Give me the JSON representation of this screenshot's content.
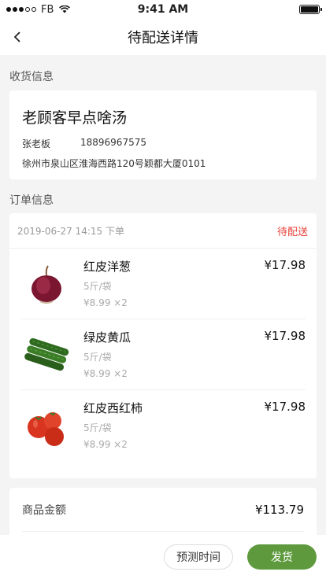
{
  "status_bar": {
    "carrier": "FB",
    "time": "9:41 AM"
  },
  "nav": {
    "title": "待配送详情",
    "back_icon": "chevron-left-icon"
  },
  "sections": {
    "receiver": "收货信息",
    "order": "订单信息"
  },
  "receiver": {
    "shop_name": "老顾客早点啥汤",
    "contact_name": "张老板",
    "phone": "18896967575",
    "address": "徐州市泉山区淮海西路120号颖都大厦0101"
  },
  "order": {
    "time": "2019-06-27 14:15 下单",
    "status": "待配送",
    "items": [
      {
        "name": "红皮洋葱",
        "spec": "5斤/袋",
        "unit_qty": "¥8.99 ×2",
        "price": "¥17.98",
        "icon": "onion-icon"
      },
      {
        "name": "绿皮黄瓜",
        "spec": "5斤/袋",
        "unit_qty": "¥8.99 ×2",
        "price": "¥17.98",
        "icon": "cucumber-icon"
      },
      {
        "name": "红皮西红柿",
        "spec": "5斤/袋",
        "unit_qty": "¥8.99 ×2",
        "price": "¥17.98",
        "icon": "tomato-icon"
      }
    ]
  },
  "summary": {
    "label": "商品金额",
    "value": "¥113.79"
  },
  "actions": {
    "predict_time": "预测时间",
    "ship": "发货"
  },
  "colors": {
    "accent_green": "#5e9a3d",
    "status_red": "#e8413a"
  }
}
